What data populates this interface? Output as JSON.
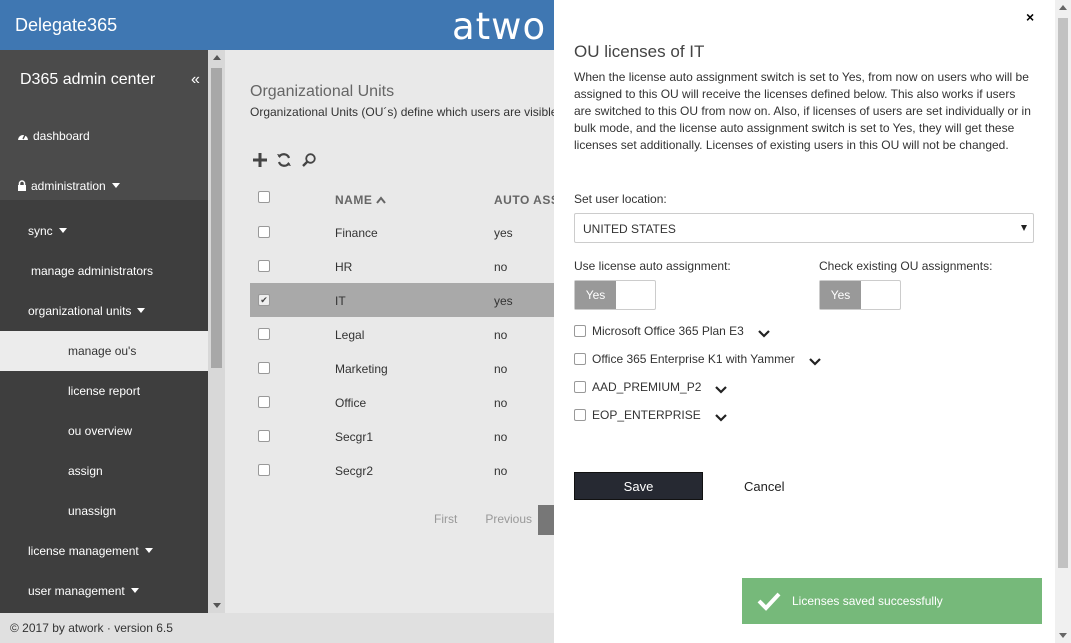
{
  "header": {
    "brand": "Delegate365",
    "logo": "atwo"
  },
  "sidebar": {
    "title": "D365 admin center",
    "collapse": "«",
    "items": [
      {
        "label": "dashboard"
      },
      {
        "label": "administration"
      },
      {
        "label": "sync"
      },
      {
        "label": "manage administrators"
      },
      {
        "label": "organizational units"
      },
      {
        "label": "manage ou's"
      },
      {
        "label": "license report"
      },
      {
        "label": "ou overview"
      },
      {
        "label": "assign"
      },
      {
        "label": "unassign"
      },
      {
        "label": "license management"
      },
      {
        "label": "user management"
      }
    ]
  },
  "main": {
    "title": "Organizational Units",
    "description": "Organizational Units (OU´s) define which users are visible",
    "columns": {
      "name": "NAME",
      "auto": "AUTO ASS"
    },
    "rows": [
      {
        "name": "Finance",
        "auto": "yes"
      },
      {
        "name": "HR",
        "auto": "no"
      },
      {
        "name": "IT",
        "auto": "yes"
      },
      {
        "name": "Legal",
        "auto": "no"
      },
      {
        "name": "Marketing",
        "auto": "no"
      },
      {
        "name": "Office",
        "auto": "no"
      },
      {
        "name": "Secgr1",
        "auto": "no"
      },
      {
        "name": "Secgr2",
        "auto": "no"
      }
    ],
    "pager": {
      "first": "First",
      "previous": "Previous"
    }
  },
  "footer": {
    "text": "© 2017 by atwork · version 6.5"
  },
  "panel": {
    "close": "×",
    "title": "OU licenses of IT",
    "description": "When the license auto assignment switch is set to Yes, from now on users who will be assigned to this OU will receive the licenses defined below. This also works if users are switched to this OU from now on. Also, if licenses of users are set individually or in bulk mode, and the license auto assignment switch is set to Yes, they will get these licenses set additionally. Licenses of existing users in this OU will not be changed.",
    "location_label": "Set user location:",
    "location_value": "UNITED STATES",
    "auto_label": "Use license auto assignment:",
    "auto_value": "Yes",
    "check_label": "Check existing OU assignments:",
    "check_value": "Yes",
    "licenses": [
      {
        "name": "Microsoft Office 365 Plan E3"
      },
      {
        "name": "Office 365 Enterprise K1 with Yammer"
      },
      {
        "name": "AAD_PREMIUM_P2"
      },
      {
        "name": "EOP_ENTERPRISE"
      }
    ],
    "save": "Save",
    "cancel": "Cancel"
  },
  "toast": {
    "message": "Licenses saved successfully"
  },
  "colors": {
    "header": "#3f77b2",
    "sidebar": "#4b4b4b",
    "toast": "#76b97a",
    "save": "#262932"
  }
}
